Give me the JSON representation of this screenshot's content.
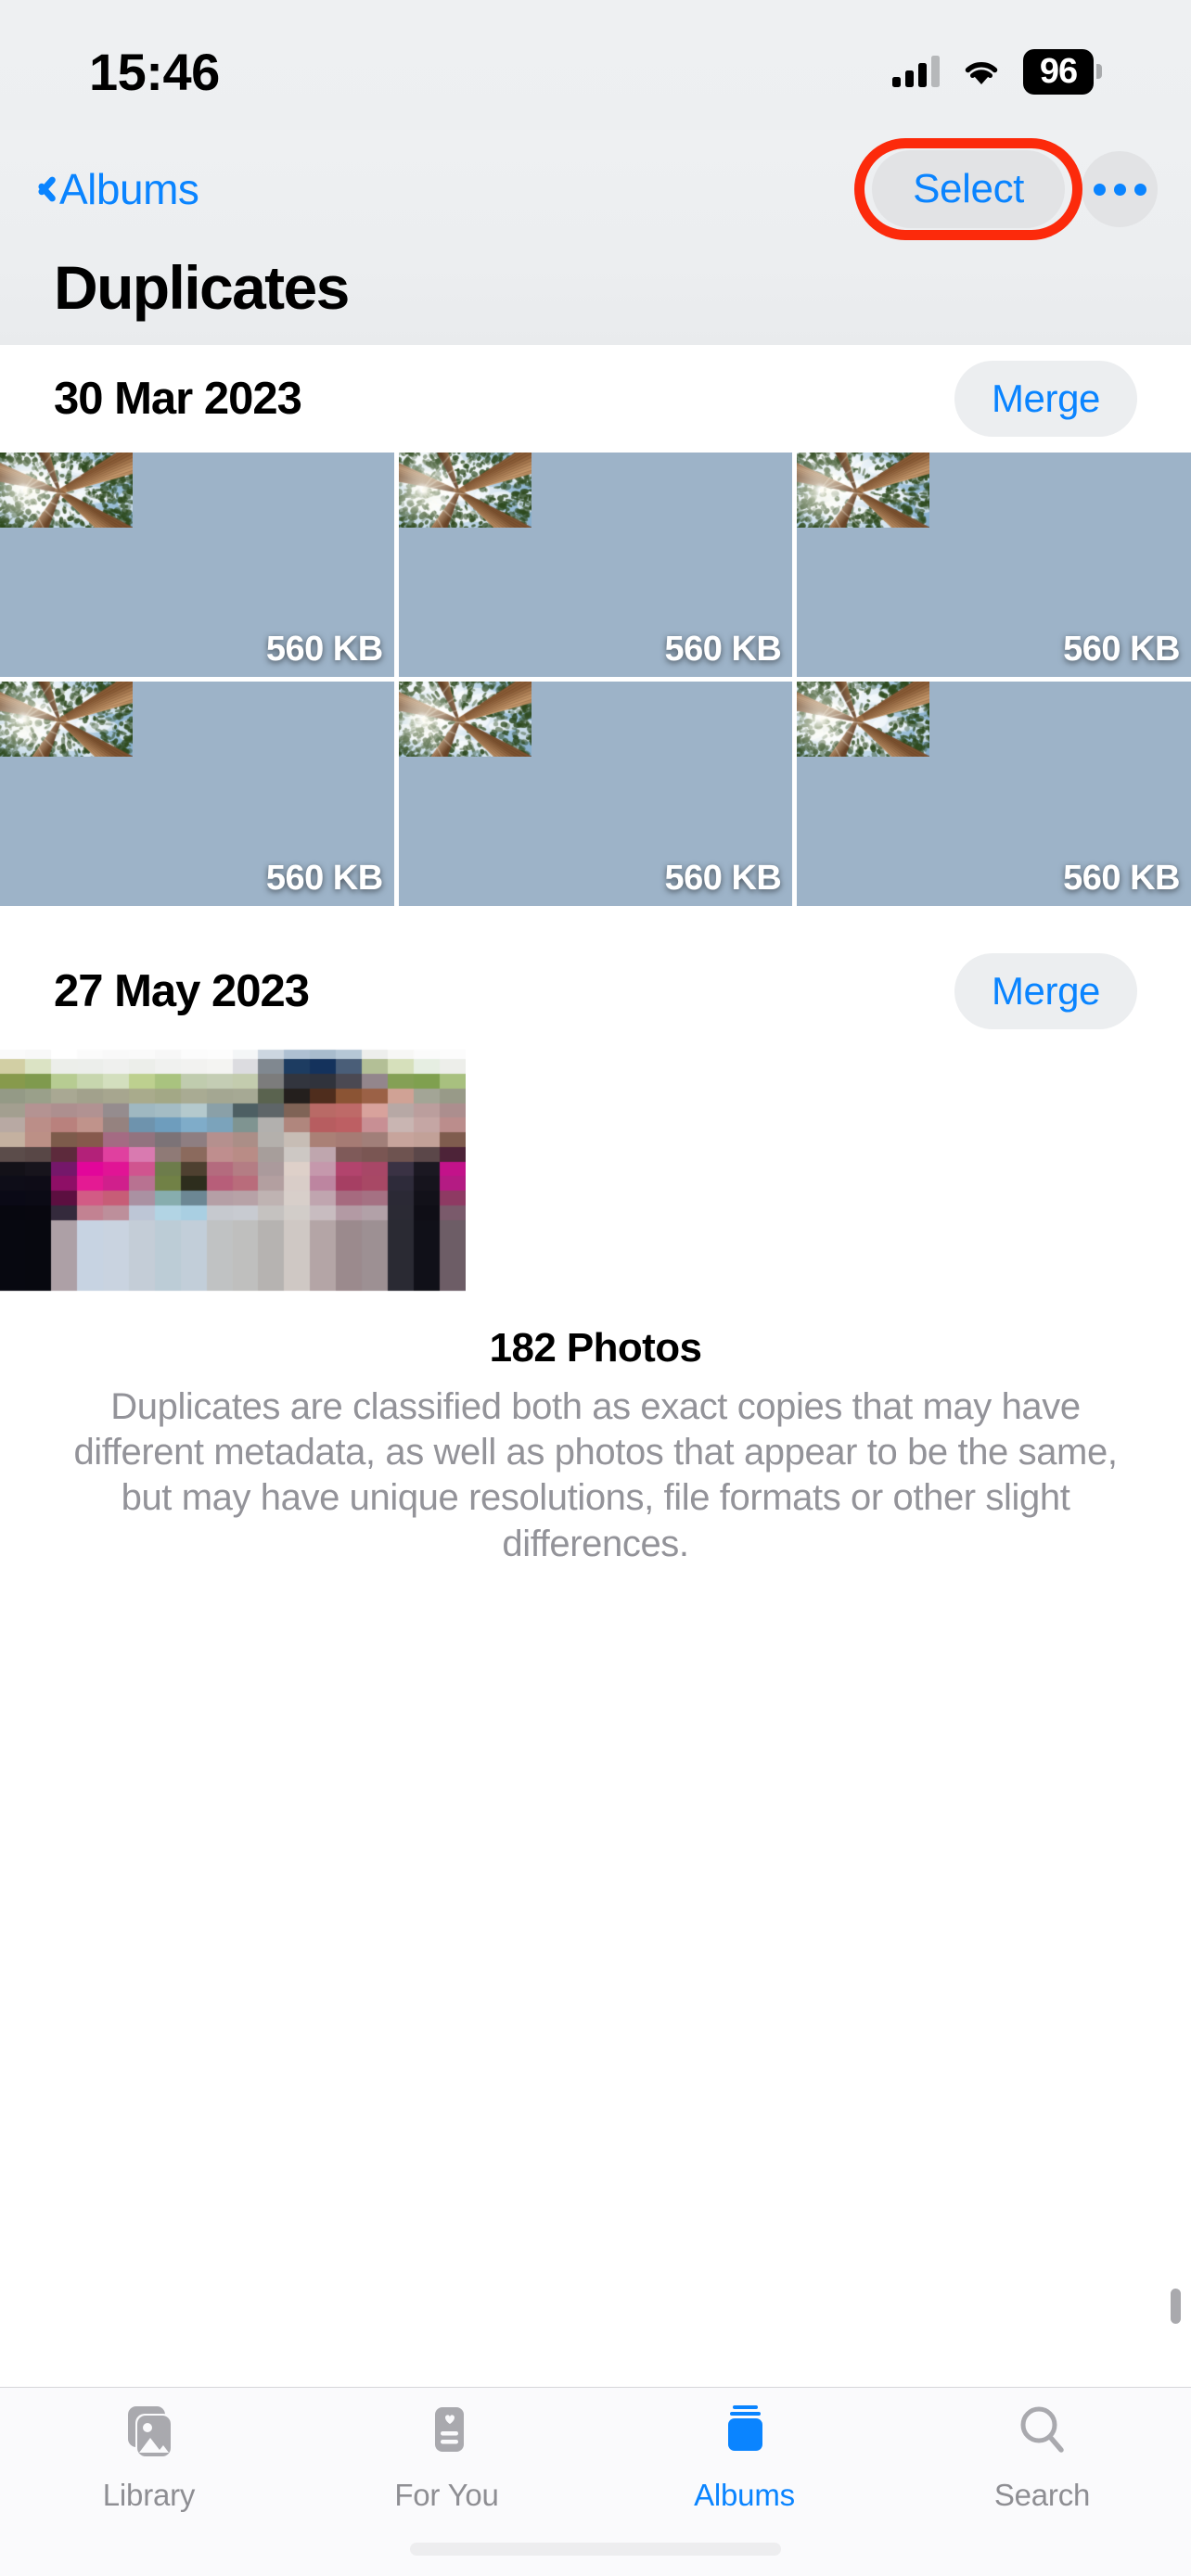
{
  "status_bar": {
    "time": "15:46",
    "battery_percent": "96",
    "signal_icon": "cellular-signal-icon",
    "wifi_icon": "wifi-icon",
    "battery_icon": "battery-icon"
  },
  "nav": {
    "back_label": "Albums",
    "back_icon": "chevron-left-icon",
    "select_label": "Select",
    "more_icon": "ellipsis-icon",
    "title": "Duplicates",
    "highlight_color": "#fc2a0b",
    "accent_color": "#0a84ff"
  },
  "sections": [
    {
      "date": "30 Mar 2023",
      "merge_label": "Merge",
      "photos": [
        {
          "size": "560 KB"
        },
        {
          "size": "560 KB"
        },
        {
          "size": "560 KB"
        },
        {
          "size": "560 KB"
        },
        {
          "size": "560 KB"
        },
        {
          "size": "560 KB"
        }
      ]
    },
    {
      "date": "27 May 2023",
      "merge_label": "Merge",
      "photos": [
        {
          "size": ""
        }
      ]
    }
  ],
  "footer": {
    "photo_count": "182 Photos",
    "description": "Duplicates are classified both as exact copies that may have different metadata, as well as photos that appear to be the same, but may have unique resolutions, file formats or other slight differences."
  },
  "tabbar": {
    "items": [
      {
        "label": "Library",
        "icon": "photos-library-icon",
        "active": false
      },
      {
        "label": "For You",
        "icon": "for-you-icon",
        "active": false
      },
      {
        "label": "Albums",
        "icon": "albums-icon",
        "active": true
      },
      {
        "label": "Search",
        "icon": "search-icon",
        "active": false
      }
    ]
  }
}
